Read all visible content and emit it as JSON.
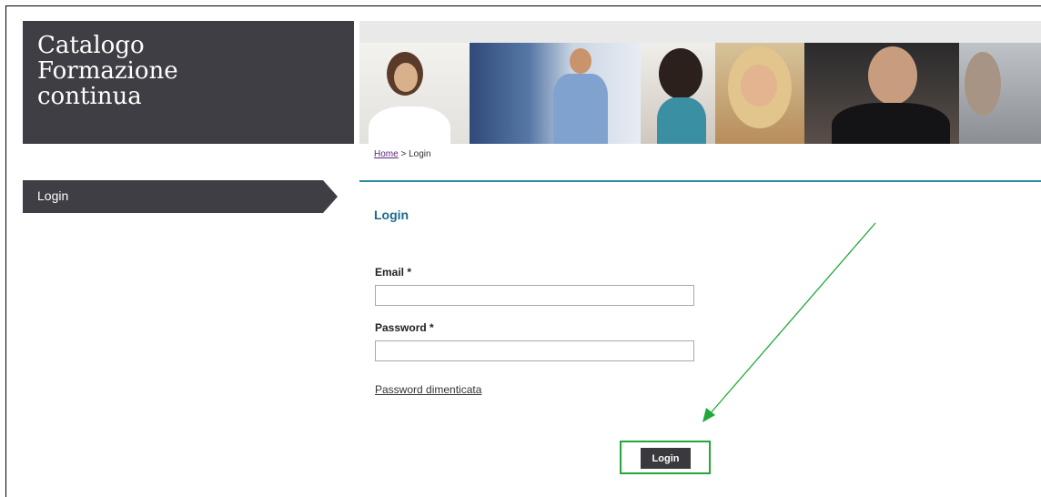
{
  "brand": {
    "title": "Catalogo\nFormazione\ncontinua"
  },
  "breadcrumb": {
    "home": "Home",
    "separator": " > ",
    "current": "Login"
  },
  "sidebar": {
    "items": [
      {
        "label": "Login"
      }
    ]
  },
  "main": {
    "heading": "Login",
    "email": {
      "label": "Email *",
      "value": ""
    },
    "password": {
      "label": "Password *",
      "value": ""
    },
    "forgot_link": "Password dimenticata",
    "submit_label": "Login"
  },
  "annotation": {
    "color": "#22a83a"
  },
  "colors": {
    "brand_bg": "#3e3e44",
    "accent_rule": "#2a8aa0",
    "heading": "#1c6a8c"
  }
}
